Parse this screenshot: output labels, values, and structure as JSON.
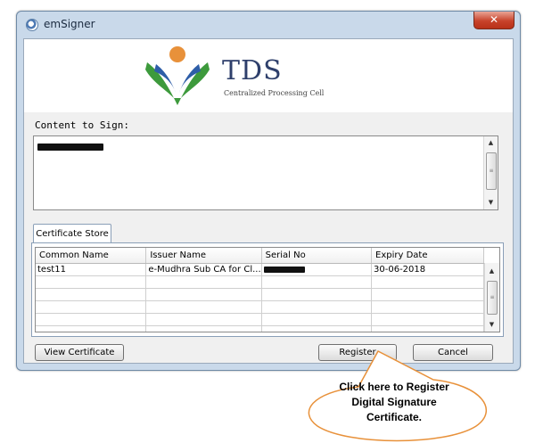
{
  "window": {
    "title": "emSigner",
    "close_glyph": "✕"
  },
  "banner": {
    "logo_title": "TDS",
    "logo_subtitle": "Centralized Processing Cell"
  },
  "content": {
    "label": "Content to Sign:"
  },
  "certificate_store": {
    "tab_label": "Certificate Store",
    "columns": [
      "Common Name",
      "Issuer Name",
      "Serial No",
      "Expiry Date"
    ],
    "rows": [
      {
        "common_name": "test11",
        "issuer_name": "e-Mudhra Sub CA for Cl...",
        "expiry_date": "30-06-2018"
      }
    ]
  },
  "buttons": {
    "view_certificate": "View Certificate",
    "register": "Register",
    "cancel": "Cancel"
  },
  "callout": {
    "line1": "Click here to Register",
    "line2": "Digital Signature",
    "line3": "Certificate."
  },
  "colors": {
    "accent_orange": "#e8913a",
    "logo_blue": "#2e5ea8",
    "logo_green": "#3d9a3c",
    "close_red": "#c8432b"
  }
}
